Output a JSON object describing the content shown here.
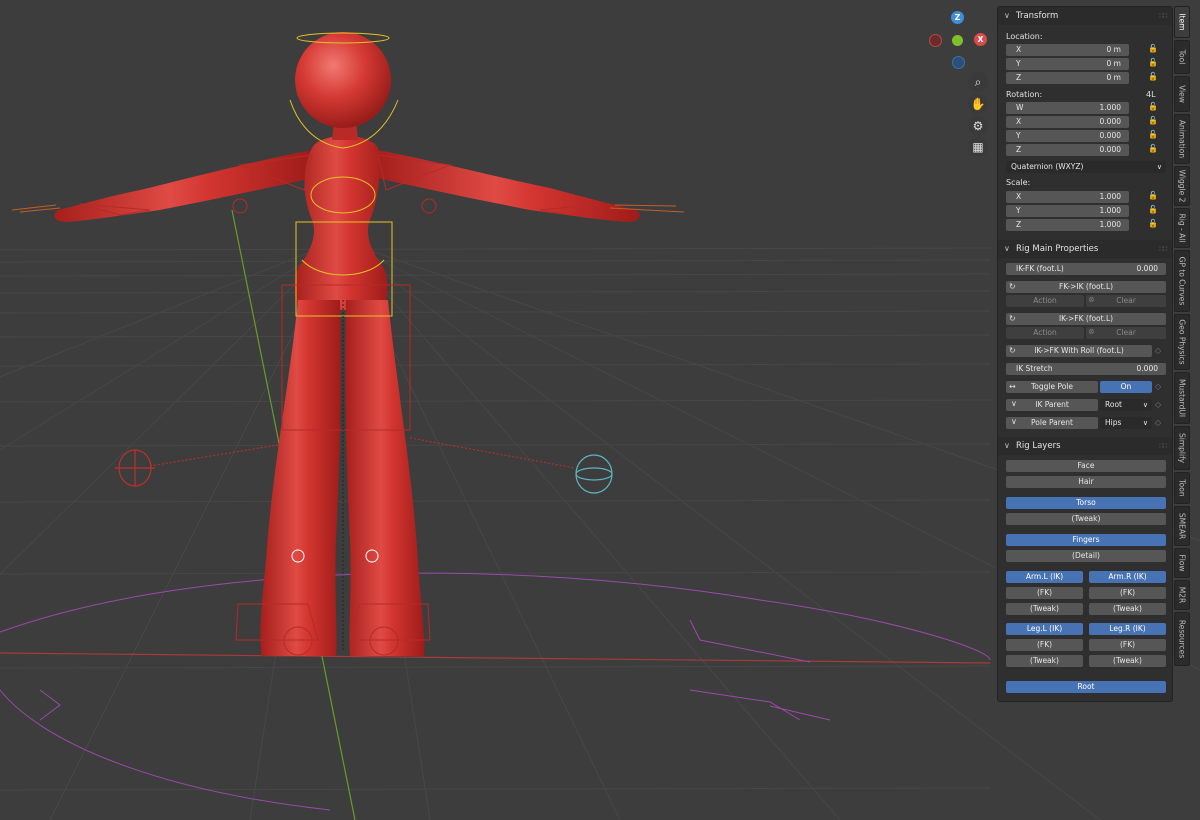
{
  "viewport": {
    "gizmo": {
      "z": "Z",
      "x": "X"
    },
    "nav_buttons": [
      "zoom-icon",
      "hand-pan-icon",
      "camera-icon",
      "grid-perspective-icon"
    ]
  },
  "transform": {
    "title": "Transform",
    "location_label": "Location:",
    "location": [
      {
        "axis": "X",
        "value": "0 m"
      },
      {
        "axis": "Y",
        "value": "0 m"
      },
      {
        "axis": "Z",
        "value": "0 m"
      }
    ],
    "rotation_label": "Rotation:",
    "rotation_mode_tag": "4L",
    "rotation": [
      {
        "axis": "W",
        "value": "1.000"
      },
      {
        "axis": "X",
        "value": "0.000"
      },
      {
        "axis": "Y",
        "value": "0.000"
      },
      {
        "axis": "Z",
        "value": "0.000"
      }
    ],
    "rotation_mode": "Quaternion (WXYZ)",
    "scale_label": "Scale:",
    "scale": [
      {
        "axis": "X",
        "value": "1.000"
      },
      {
        "axis": "Y",
        "value": "1.000"
      },
      {
        "axis": "Z",
        "value": "1.000"
      }
    ]
  },
  "rig_main": {
    "title": "Rig Main Properties",
    "ikfk_label": "IK-FK (foot.L)",
    "ikfk_value": "0.000",
    "fk_to_ik": "FK->IK (foot.L)",
    "ik_to_fk": "IK->FK (foot.L)",
    "action": "Action",
    "clear": "Clear",
    "ik_fk_roll": "IK->FK With Roll (foot.L)",
    "ik_stretch_label": "IK Stretch",
    "ik_stretch_value": "0.000",
    "toggle_pole_label": "Toggle Pole",
    "toggle_pole_value": "On",
    "ik_parent_label": "IK Parent",
    "ik_parent_value": "Root",
    "pole_parent_label": "Pole Parent",
    "pole_parent_value": "Hips"
  },
  "rig_layers": {
    "title": "Rig Layers",
    "face": "Face",
    "hair": "Hair",
    "torso": "Torso",
    "torso_tweak": "(Tweak)",
    "fingers": "Fingers",
    "fingers_detail": "(Detail)",
    "arm_l_ik": "Arm.L (IK)",
    "arm_r_ik": "Arm.R (IK)",
    "fk": "(FK)",
    "tweak": "(Tweak)",
    "leg_l_ik": "Leg.L (IK)",
    "leg_r_ik": "Leg.R (IK)",
    "root": "Root"
  },
  "tabs": [
    "Item",
    "Tool",
    "View",
    "Animation",
    "Wiggle 2",
    "Rig - All",
    "GP to Curves",
    "Geo Physics",
    "MustardUI",
    "Simplify",
    "Toon",
    "SMEAR",
    "Flow",
    "M2R",
    "Resources"
  ],
  "colors": {
    "accent_blue": "#4772b3",
    "model_red": "#d93a36",
    "rig_yellow": "#e6c228",
    "axis_x": "#d94b4b",
    "axis_y": "#7fbf2a",
    "axis_z": "#3d8fd9"
  }
}
